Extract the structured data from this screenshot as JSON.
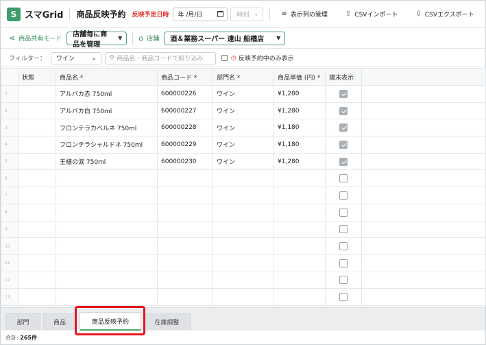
{
  "header": {
    "logo_icon": "app-logo-icon",
    "app_title": "スマGrid",
    "page_title": "商品反映予約",
    "date_label": "反映予定日時",
    "date_value": "年 /月/日",
    "time_placeholder": "時刻",
    "buttons": [
      {
        "label": "表示列の管理",
        "icon": "list-icon"
      },
      {
        "label": "CSVインポート",
        "icon": "upload-icon"
      },
      {
        "label": "CSVエクスポート",
        "icon": "download-icon"
      }
    ]
  },
  "scope_bar": {
    "mode_label": "商品共有モード",
    "mode_value": "店舗毎に商品を管理",
    "store_label": "店舗",
    "store_value": "酒＆業務スーパー 遠山 船橋店"
  },
  "filter_bar": {
    "label": "フィルター：",
    "select_value": "ワイン",
    "search_placeholder": "商品名・商品コードで絞り込み",
    "reserve_only_label": "反映予約中のみ表示"
  },
  "grid": {
    "columns": [
      "",
      "状態",
      "商品名 *",
      "商品コード *",
      "部門名 *",
      "商品単価 (円) *",
      "端末表示"
    ],
    "rows": [
      {
        "num": "1",
        "status": "",
        "name": "アルパカ赤 750ml",
        "code": "600000226",
        "dept": "ワイン",
        "price": "¥1,280",
        "display": true
      },
      {
        "num": "2",
        "status": "",
        "name": "アルパカ白 750ml",
        "code": "600000227",
        "dept": "ワイン",
        "price": "¥1,280",
        "display": true
      },
      {
        "num": "3",
        "status": "",
        "name": "フロンテラカベルネ 750ml",
        "code": "600000228",
        "dept": "ワイン",
        "price": "¥1,180",
        "display": true
      },
      {
        "num": "4",
        "status": "",
        "name": "フロンテラシャルドネ 750ml",
        "code": "600000229",
        "dept": "ワイン",
        "price": "¥1,180",
        "display": true
      },
      {
        "num": "5",
        "status": "",
        "name": "王様の涙 750ml",
        "code": "600000230",
        "dept": "ワイン",
        "price": "¥1,280",
        "display": true
      },
      {
        "num": "6",
        "status": "",
        "name": "",
        "code": "",
        "dept": "",
        "price": "",
        "display": false
      },
      {
        "num": "7",
        "status": "",
        "name": "",
        "code": "",
        "dept": "",
        "price": "",
        "display": false
      },
      {
        "num": "8",
        "status": "",
        "name": "",
        "code": "",
        "dept": "",
        "price": "",
        "display": false
      },
      {
        "num": "9",
        "status": "",
        "name": "",
        "code": "",
        "dept": "",
        "price": "",
        "display": false
      },
      {
        "num": "10",
        "status": "",
        "name": "",
        "code": "",
        "dept": "",
        "price": "",
        "display": false
      },
      {
        "num": "11",
        "status": "",
        "name": "",
        "code": "",
        "dept": "",
        "price": "",
        "display": false
      },
      {
        "num": "12",
        "status": "",
        "name": "",
        "code": "",
        "dept": "",
        "price": "",
        "display": false
      },
      {
        "num": "13",
        "status": "",
        "name": "",
        "code": "",
        "dept": "",
        "price": "",
        "display": false
      }
    ]
  },
  "tabs": [
    {
      "label": "部門",
      "active": false
    },
    {
      "label": "商品",
      "active": false
    },
    {
      "label": "商品反映予約",
      "active": true
    },
    {
      "label": "在庫調整",
      "active": false
    }
  ],
  "footer": {
    "total_label": "合計: ",
    "total_value": "265件"
  },
  "colors": {
    "accent": "#4aa37a",
    "alert": "#e0312b",
    "highlight": "#e8141e"
  }
}
